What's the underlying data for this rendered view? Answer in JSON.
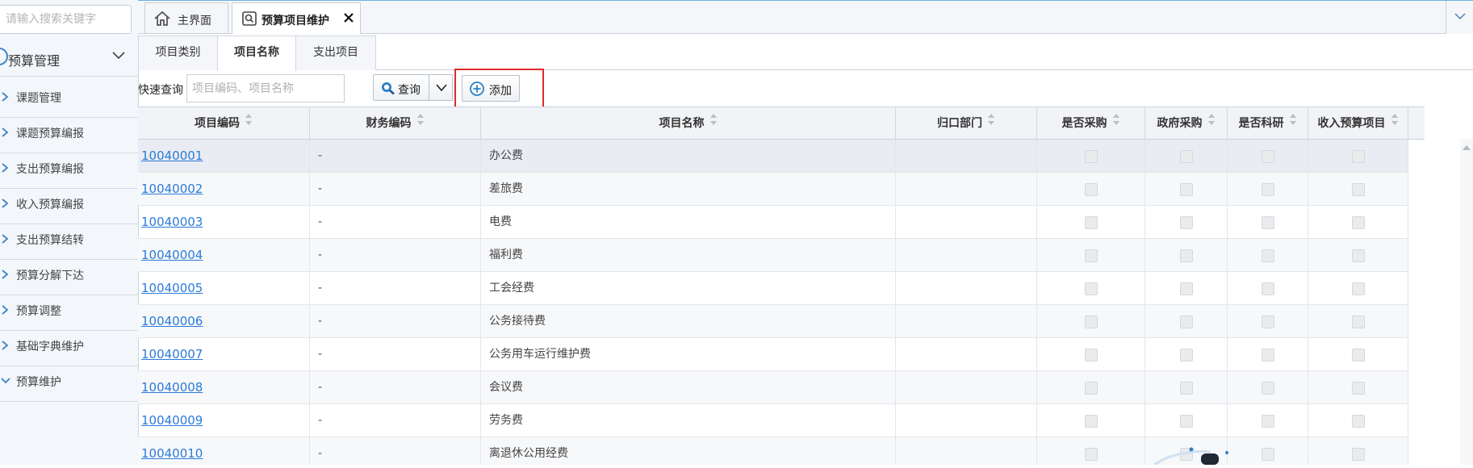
{
  "sidebar": {
    "search_placeholder": "请输入搜索关键字",
    "section_title": "预算管理",
    "items": [
      {
        "label": "课题管理",
        "expanded": false
      },
      {
        "label": "课题预算编报",
        "expanded": false
      },
      {
        "label": "支出预算编报",
        "expanded": false
      },
      {
        "label": "收入预算编报",
        "expanded": false
      },
      {
        "label": "支出预算结转",
        "expanded": false
      },
      {
        "label": "预算分解下达",
        "expanded": false
      },
      {
        "label": "预算调整",
        "expanded": false
      },
      {
        "label": "基础字典维护",
        "expanded": false
      },
      {
        "label": "预算维护",
        "expanded": true
      }
    ]
  },
  "tabs": {
    "home": "主界面",
    "active": "预算项目维护"
  },
  "subtabs": [
    "项目类别",
    "项目名称",
    "支出项目"
  ],
  "toolbar": {
    "quick_query_label": "快速查询",
    "query_placeholder": "项目编码、项目名称",
    "query_button": "查询",
    "add_button": "添加"
  },
  "table": {
    "columns": [
      "项目编码",
      "财务编码",
      "项目名称",
      "归口部门",
      "是否采购",
      "政府采购",
      "是否科研",
      "收入预算项目"
    ],
    "rows": [
      {
        "code": "10040001",
        "fin": "-",
        "name": "办公费"
      },
      {
        "code": "10040002",
        "fin": "-",
        "name": "差旅费"
      },
      {
        "code": "10040003",
        "fin": "-",
        "name": "电费"
      },
      {
        "code": "10040004",
        "fin": "-",
        "name": "福利费"
      },
      {
        "code": "10040005",
        "fin": "-",
        "name": "工会经费"
      },
      {
        "code": "10040006",
        "fin": "-",
        "name": "公务接待费"
      },
      {
        "code": "10040007",
        "fin": "-",
        "name": "公务用车运行维护费"
      },
      {
        "code": "10040008",
        "fin": "-",
        "name": "会议费"
      },
      {
        "code": "10040009",
        "fin": "-",
        "name": "劳务费"
      },
      {
        "code": "10040010",
        "fin": "-",
        "name": "离退休公用经费"
      }
    ]
  },
  "colors": {
    "accent": "#2b7bd8",
    "highlight_box": "#e0282c",
    "icon_blue": "#2d7fc6"
  }
}
